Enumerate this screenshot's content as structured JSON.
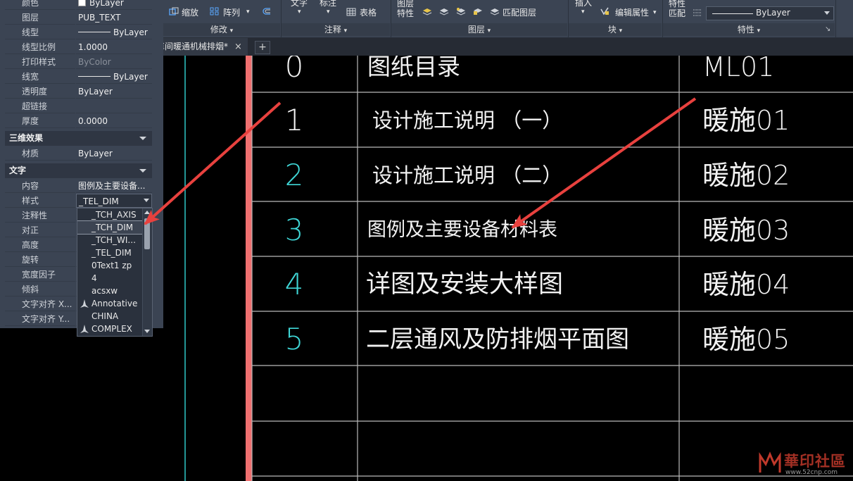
{
  "properties": {
    "rows_top": [
      {
        "key": "颜色",
        "value": "ByLayer",
        "style": "swatch"
      },
      {
        "key": "图层",
        "value": "PUB_TEXT",
        "style": ""
      },
      {
        "key": "线型",
        "value": "ByLayer",
        "style": "line"
      },
      {
        "key": "线型比例",
        "value": "1.0000",
        "style": ""
      },
      {
        "key": "打印样式",
        "value": "ByColor",
        "style": "dim"
      },
      {
        "key": "线宽",
        "value": "ByLayer",
        "style": "line"
      },
      {
        "key": "透明度",
        "value": "ByLayer",
        "style": ""
      },
      {
        "key": "超链接",
        "value": "",
        "style": ""
      },
      {
        "key": "厚度",
        "value": "0.0000",
        "style": ""
      }
    ],
    "section_3d": "三维效果",
    "material_key": "材质",
    "material_value": "ByLayer",
    "section_text": "文字",
    "content_key": "内容",
    "content_value": "图例及主要设备...",
    "style_key": "样式",
    "style_value": "_TEL_DIM",
    "rows_text": [
      "注释性",
      "对正",
      "高度",
      "旋转",
      "宽度因子",
      "倾斜",
      "文字对齐 X...",
      "文字对齐 Y..."
    ]
  },
  "style_dropdown": {
    "items": [
      {
        "label": "_TCH_AXIS",
        "icon": false,
        "highlight": false
      },
      {
        "label": "_TCH_DIM",
        "icon": false,
        "highlight": true
      },
      {
        "label": "_TCH_WI...",
        "icon": false,
        "highlight": false
      },
      {
        "label": "_TEL_DIM",
        "icon": false,
        "highlight": false
      },
      {
        "label": "0Text1 zp",
        "icon": false,
        "highlight": false
      },
      {
        "label": "4",
        "icon": false,
        "highlight": false
      },
      {
        "label": "acsxw",
        "icon": false,
        "highlight": false
      },
      {
        "label": "Annotative",
        "icon": true,
        "highlight": false
      },
      {
        "label": "CHINA",
        "icon": false,
        "highlight": false
      },
      {
        "label": "COMPLEX",
        "icon": true,
        "highlight": false
      }
    ]
  },
  "ribbon": {
    "scale_label": "缩放",
    "array_label": "阵列",
    "modify_panel": "修改",
    "text_label": "文字",
    "dim_label": "标注",
    "table_label": "表格",
    "annotation_panel": "注释",
    "layer_props_label": "图层\n特性",
    "match_layer_label": "匹配图层",
    "layers_panel": "图层",
    "insert_label": "插入",
    "edit_attr_label": "编辑属性",
    "block_panel": "块",
    "match_props_label": "特性\n匹配",
    "lineweight_value": "ByLayer",
    "properties_panel": "特性"
  },
  "tabs": {
    "doc_title": "車间暖通机械排烟*",
    "close": "×",
    "new_tab": "+"
  },
  "table": {
    "rows": [
      {
        "num": "0",
        "title": "图纸目录",
        "code": "ML01",
        "num_color": "#f2f2f2"
      },
      {
        "num": "1",
        "title": "设计施工说明  （一）",
        "code": "暖施01",
        "num_color": "#f2f2f2"
      },
      {
        "num": "2",
        "title": "设计施工说明  （二）",
        "code": "暖施02",
        "num_color": "#3fd6d6"
      },
      {
        "num": "3",
        "title": "图例及主要设备材料表",
        "code": "暖施03",
        "num_color": "#3fd6d6"
      },
      {
        "num": "4",
        "title": "详图及安装大样图",
        "code": "暖施04",
        "num_color": "#3fd6d6"
      },
      {
        "num": "5",
        "title": "二层通风及防排烟平面图",
        "code": "暖施05",
        "num_color": "#3fd6d6"
      }
    ]
  },
  "colors": {
    "annotation_arrow": "#e8413e",
    "border_strip": "#f07070",
    "cyan_line": "#2fc7c7"
  },
  "watermark": {
    "text": "華印社區",
    "url": "www.52cnp.com"
  }
}
